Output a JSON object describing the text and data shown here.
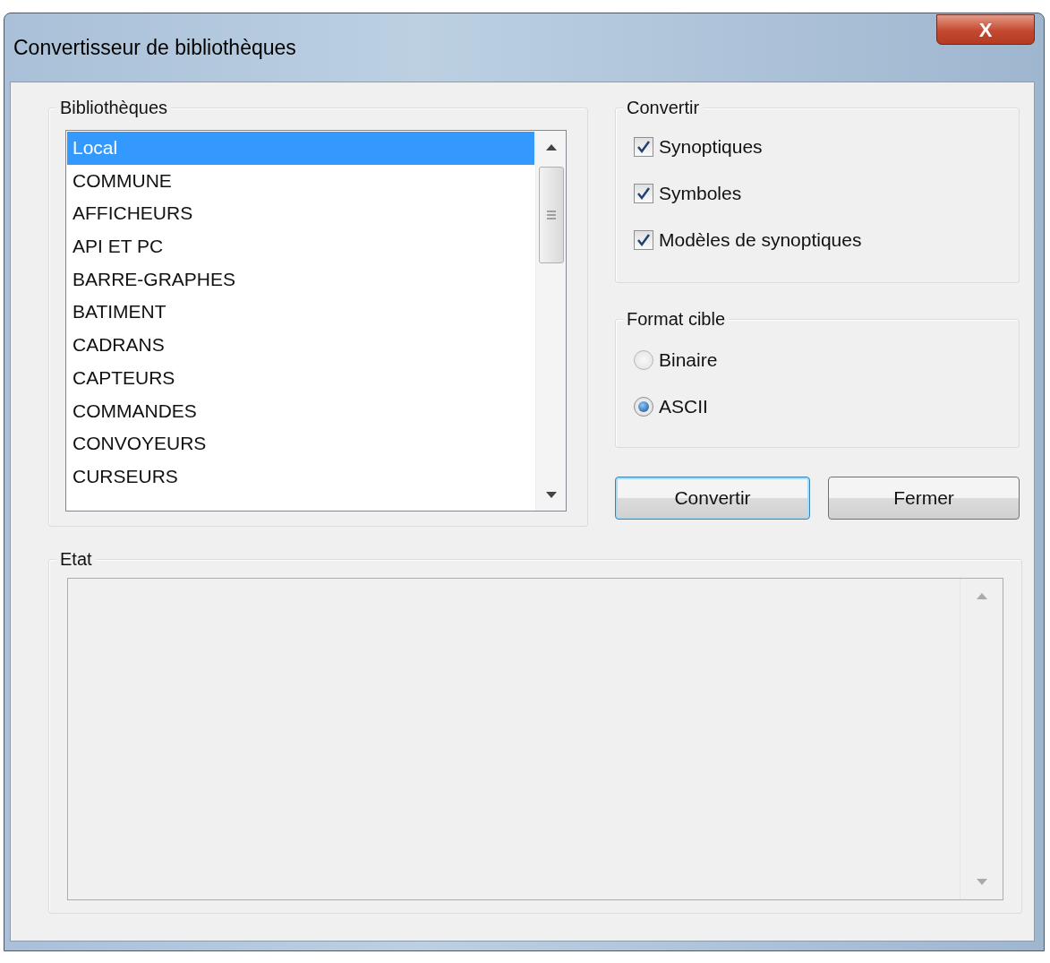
{
  "window": {
    "title": "Convertisseur de bibliothèques",
    "close_label": "X"
  },
  "libraries": {
    "label": "Bibliothèques",
    "items": [
      {
        "label": "Local",
        "selected": true
      },
      {
        "label": "COMMUNE",
        "selected": false
      },
      {
        "label": "AFFICHEURS",
        "selected": false
      },
      {
        "label": "API ET PC",
        "selected": false
      },
      {
        "label": "BARRE-GRAPHES",
        "selected": false
      },
      {
        "label": "BATIMENT",
        "selected": false
      },
      {
        "label": "CADRANS",
        "selected": false
      },
      {
        "label": "CAPTEURS",
        "selected": false
      },
      {
        "label": "COMMANDES",
        "selected": false
      },
      {
        "label": "CONVOYEURS",
        "selected": false
      },
      {
        "label": "CURSEURS",
        "selected": false
      }
    ]
  },
  "convert": {
    "label": "Convertir",
    "options": [
      {
        "label": "Synoptiques",
        "checked": true
      },
      {
        "label": "Symboles",
        "checked": true
      },
      {
        "label": "Modèles de synoptiques",
        "checked": true
      }
    ]
  },
  "target_format": {
    "label": "Format cible",
    "options": [
      {
        "label": "Binaire",
        "selected": false
      },
      {
        "label": "ASCII",
        "selected": true
      }
    ]
  },
  "buttons": [
    {
      "label": "Convertir",
      "focused": true
    },
    {
      "label": "Fermer",
      "focused": false
    }
  ],
  "status": {
    "label": "Etat"
  }
}
